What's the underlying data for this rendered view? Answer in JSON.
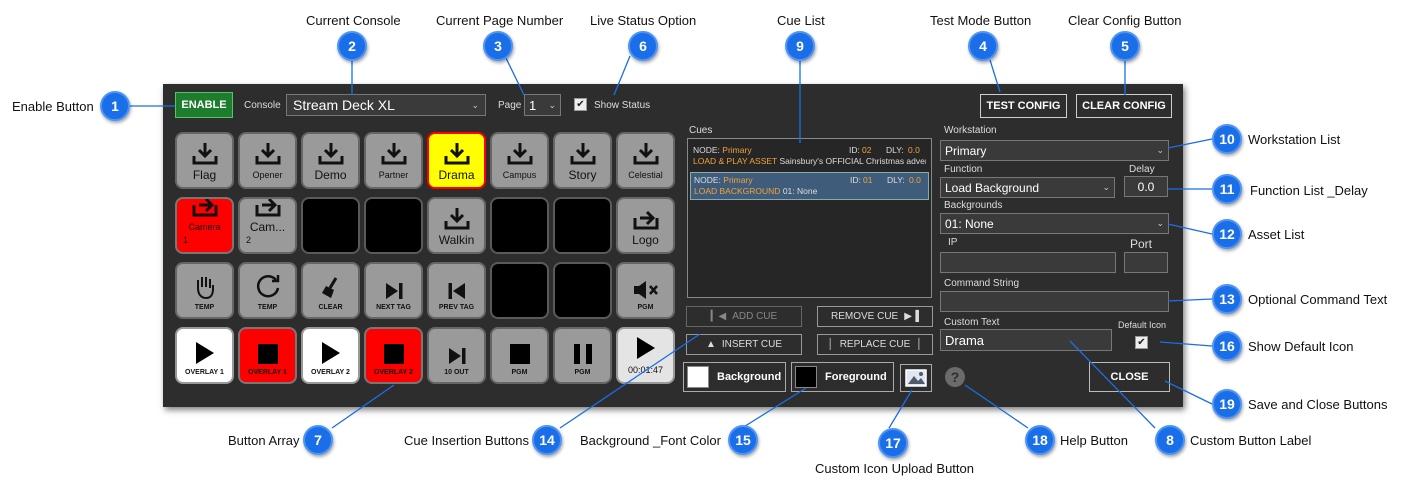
{
  "annotations": [
    {
      "num": "1",
      "label": "Enable Button"
    },
    {
      "num": "2",
      "label": "Current Console"
    },
    {
      "num": "3",
      "label": "Current Page Number"
    },
    {
      "num": "6",
      "label": "Live Status Option"
    },
    {
      "num": "9",
      "label": "Cue List"
    },
    {
      "num": "4",
      "label": "Test Mode Button"
    },
    {
      "num": "5",
      "label": "Clear Config Button"
    },
    {
      "num": "10",
      "label": "Workstation List"
    },
    {
      "num": "11",
      "label": "Function List _Delay"
    },
    {
      "num": "12",
      "label": "Asset List"
    },
    {
      "num": "13",
      "label": "Optional Command Text"
    },
    {
      "num": "16",
      "label": "Show Default Icon"
    },
    {
      "num": "19",
      "label": "Save and Close Buttons"
    },
    {
      "num": "7",
      "label": "Button Array"
    },
    {
      "num": "14",
      "label": "Cue Insertion Buttons"
    },
    {
      "num": "15",
      "label": "Background _Font Color"
    },
    {
      "num": "17",
      "label": "Custom Icon Upload Button"
    },
    {
      "num": "18",
      "label": "Help Button"
    },
    {
      "num": "8",
      "label": "Custom Button Label"
    }
  ],
  "toolbar": {
    "enable_label": "ENABLE",
    "console_label": "Console",
    "console_value": "Stream Deck XL",
    "page_label": "Page",
    "page_value": "1",
    "show_status_label": "Show Status",
    "show_status_checked": "✔",
    "test_config_label": "TEST CONFIG",
    "clear_config_label": "CLEAR CONFIG"
  },
  "keys": [
    {
      "label": "Flag",
      "icon": "download-icon",
      "color": "gray"
    },
    {
      "label": "Opener",
      "icon": "download-icon",
      "color": "gray",
      "small": true
    },
    {
      "label": "Demo",
      "icon": "download-icon",
      "color": "gray"
    },
    {
      "label": "Partner",
      "icon": "download-icon",
      "color": "gray",
      "small": true
    },
    {
      "label": "Drama",
      "icon": "download-icon",
      "color": "yellow"
    },
    {
      "label": "Campus",
      "icon": "download-icon",
      "color": "gray",
      "small": true
    },
    {
      "label": "Story",
      "icon": "download-icon",
      "color": "gray"
    },
    {
      "label": "Celestial",
      "icon": "download-icon",
      "color": "gray",
      "small": true
    },
    {
      "label": "Camera",
      "sub": "1",
      "icon": "camera-switch-icon",
      "color": "red",
      "small": true
    },
    {
      "label": "Cam...",
      "sub": "2",
      "icon": "camera-switch-icon",
      "color": "gray"
    },
    {
      "label": "",
      "icon": "",
      "color": "black"
    },
    {
      "label": "",
      "icon": "",
      "color": "black"
    },
    {
      "label": "Walkin",
      "icon": "download-icon",
      "color": "gray"
    },
    {
      "label": "",
      "icon": "",
      "color": "black"
    },
    {
      "label": "",
      "icon": "",
      "color": "black"
    },
    {
      "label": "Logo",
      "icon": "camera-switch-icon",
      "color": "gray"
    },
    {
      "label": "TEMP",
      "icon": "hand-icon",
      "color": "gray",
      "caption": true
    },
    {
      "label": "TEMP",
      "icon": "rotate-icon",
      "color": "gray",
      "caption": true
    },
    {
      "label": "CLEAR",
      "icon": "broom-icon",
      "color": "gray",
      "caption": true
    },
    {
      "label": "NEXT TAG",
      "icon": "next-icon",
      "color": "gray",
      "caption": true
    },
    {
      "label": "PREV TAG",
      "icon": "prev-icon",
      "color": "gray",
      "caption": true
    },
    {
      "label": "",
      "icon": "",
      "color": "black"
    },
    {
      "label": "",
      "icon": "",
      "color": "black"
    },
    {
      "label": "PGM",
      "icon": "mute-icon",
      "color": "gray",
      "caption": true
    },
    {
      "label": "OVERLAY 1",
      "icon": "play-icon",
      "color": "white",
      "caption": true
    },
    {
      "label": "OVERLAY 1",
      "icon": "stop-icon",
      "color": "red",
      "caption": true
    },
    {
      "label": "OVERLAY 2",
      "icon": "play-icon",
      "color": "white",
      "caption": true
    },
    {
      "label": "OVERLAY 2",
      "icon": "stop-icon",
      "color": "red",
      "caption": true
    },
    {
      "label": "10 OUT",
      "icon": "next-icon",
      "color": "gray",
      "caption": true
    },
    {
      "label": "PGM",
      "icon": "stop-icon",
      "color": "gray",
      "caption": true
    },
    {
      "label": "PGM",
      "icon": "pause-icon",
      "color": "gray",
      "caption": true
    },
    {
      "label": "00:01:47",
      "icon": "play-icon",
      "color": "lightgray",
      "small": true
    }
  ],
  "cues": {
    "title": "Cues",
    "items": [
      {
        "node_label": "NODE:",
        "node_value": "Primary",
        "id_label": "ID:",
        "id_value": "02",
        "dly_label": "DLY:",
        "dly_value": "0.0",
        "action": "LOAD & PLAY ASSET",
        "detail": "Sainsbury's OFFICIAL Christmas adver"
      },
      {
        "node_label": "NODE:",
        "node_value": "Primary",
        "id_label": "ID:",
        "id_value": "01",
        "dly_label": "DLY:",
        "dly_value": "0.0",
        "action": "LOAD BACKGROUND",
        "detail": "01: None"
      }
    ],
    "add_label": "ADD CUE",
    "remove_label": "REMOVE CUE",
    "insert_label": "INSERT CUE",
    "replace_label": "REPLACE CUE"
  },
  "colors": {
    "background_label": "Background",
    "foreground_label": "Foreground",
    "background_color": "#ffffff",
    "foreground_color": "#000000"
  },
  "form": {
    "workstation_label": "Workstation",
    "workstation_value": "Primary",
    "function_label": "Function",
    "function_value": "Load Background",
    "delay_label": "Delay",
    "delay_value": "0.0",
    "backgrounds_label": "Backgrounds",
    "backgrounds_value": "01: None",
    "ip_label": "IP",
    "ip_value": "",
    "port_label": "Port",
    "port_value": "",
    "command_label": "Command String",
    "command_value": "",
    "custom_text_label": "Custom Text",
    "custom_text_value": "Drama",
    "default_icon_label": "Default Icon",
    "default_icon_checked": "✔",
    "help_label": "?",
    "close_label": "CLOSE"
  }
}
